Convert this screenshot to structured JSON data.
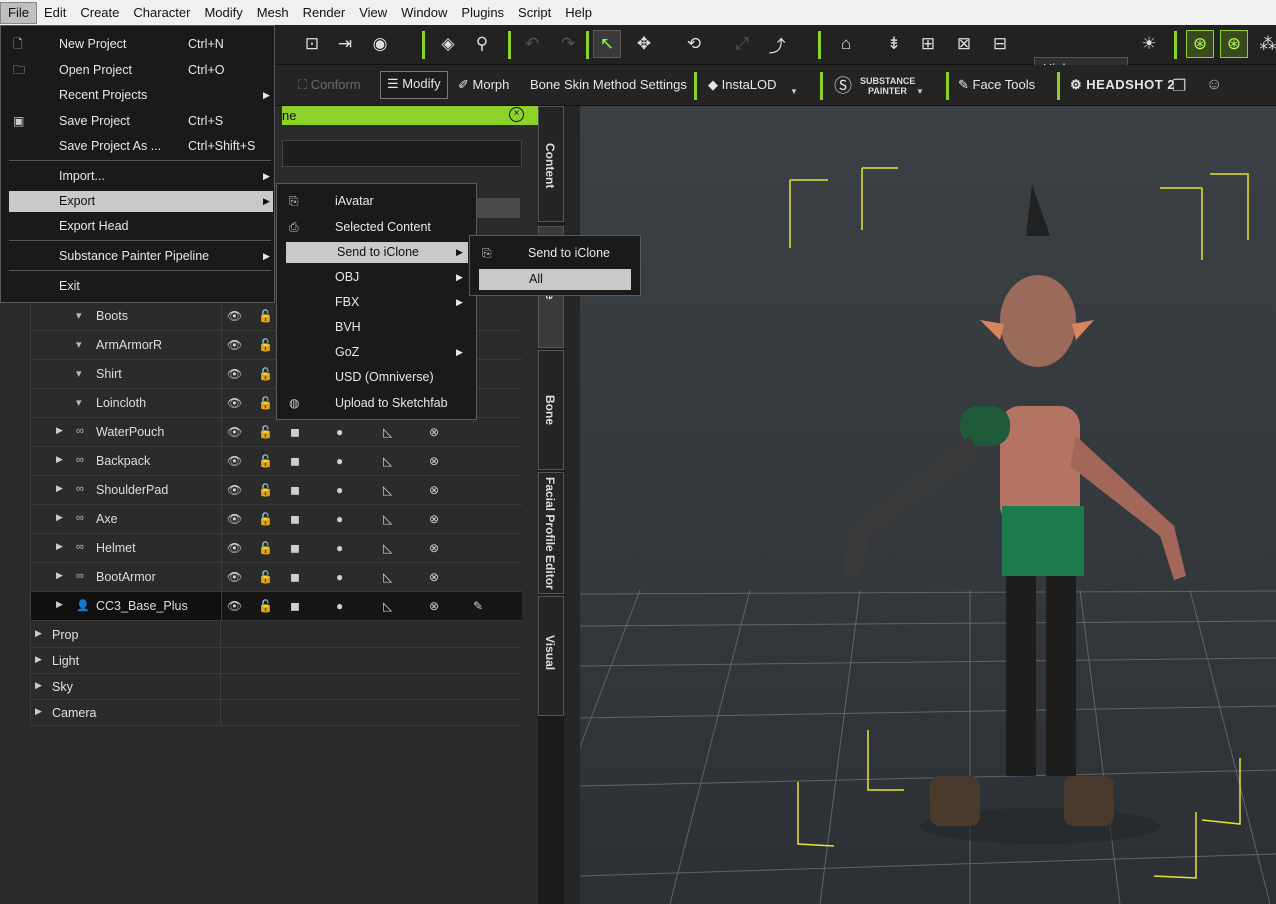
{
  "menubar": {
    "items": [
      "File",
      "Edit",
      "Create",
      "Character",
      "Modify",
      "Mesh",
      "Render",
      "View",
      "Window",
      "Plugins",
      "Script",
      "Help"
    ]
  },
  "toolbar": {
    "quality": "High",
    "row2": {
      "conform": "Conform",
      "modify": "Modify",
      "morph": "Morph",
      "bone_skin": "Bone Skin Method Settings",
      "instalod": "InstaLOD",
      "substance_line1": "SUBSTANCE",
      "substance_line2": "PAINTER",
      "face_tools": "Face Tools",
      "headshot": "HEADSHOT 2"
    }
  },
  "panel": {
    "title": "ne",
    "tree_rows": [
      {
        "label": "Boots",
        "type": "cloth"
      },
      {
        "label": "ArmArmorR",
        "type": "cloth"
      },
      {
        "label": "Shirt",
        "type": "cloth"
      },
      {
        "label": "Loincloth",
        "type": "cloth"
      },
      {
        "label": "WaterPouch",
        "type": "accessory"
      },
      {
        "label": "Backpack",
        "type": "accessory"
      },
      {
        "label": "ShoulderPad",
        "type": "accessory"
      },
      {
        "label": "Axe",
        "type": "accessory"
      },
      {
        "label": "Helmet",
        "type": "accessory"
      },
      {
        "label": "BootArmor",
        "type": "accessory"
      },
      {
        "label": "CC3_Base_Plus",
        "type": "avatar"
      }
    ],
    "groups": [
      "Prop",
      "Light",
      "Sky",
      "Camera"
    ]
  },
  "side_tabs": [
    "Content",
    "e",
    "Bone",
    "Facial Profile Editor",
    "Visual"
  ],
  "file_menu": {
    "items": [
      {
        "label": "New Project",
        "shortcut": "Ctrl+N"
      },
      {
        "label": "Open Project",
        "shortcut": "Ctrl+O"
      },
      {
        "label": "Recent Projects",
        "shortcut": ""
      },
      {
        "label": "Save Project",
        "shortcut": "Ctrl+S"
      },
      {
        "label": "Save Project As ...",
        "shortcut": "Ctrl+Shift+S"
      },
      {
        "label": "Import...",
        "shortcut": ""
      },
      {
        "label": "Export",
        "shortcut": ""
      },
      {
        "label": "Export Head",
        "shortcut": ""
      },
      {
        "label": "Substance Painter Pipeline",
        "shortcut": ""
      },
      {
        "label": "Exit",
        "shortcut": ""
      }
    ]
  },
  "export_menu": {
    "items": [
      "iAvatar",
      "Selected Content",
      "Send to iClone",
      "OBJ",
      "FBX",
      "BVH",
      "GoZ",
      "USD (Omniverse)",
      "Upload to Sketchfab"
    ]
  },
  "sendto_menu": {
    "items": [
      "Send to iClone",
      "All"
    ]
  },
  "colors": {
    "accent": "#8cd22a",
    "highlight": "#c9c9c9"
  }
}
